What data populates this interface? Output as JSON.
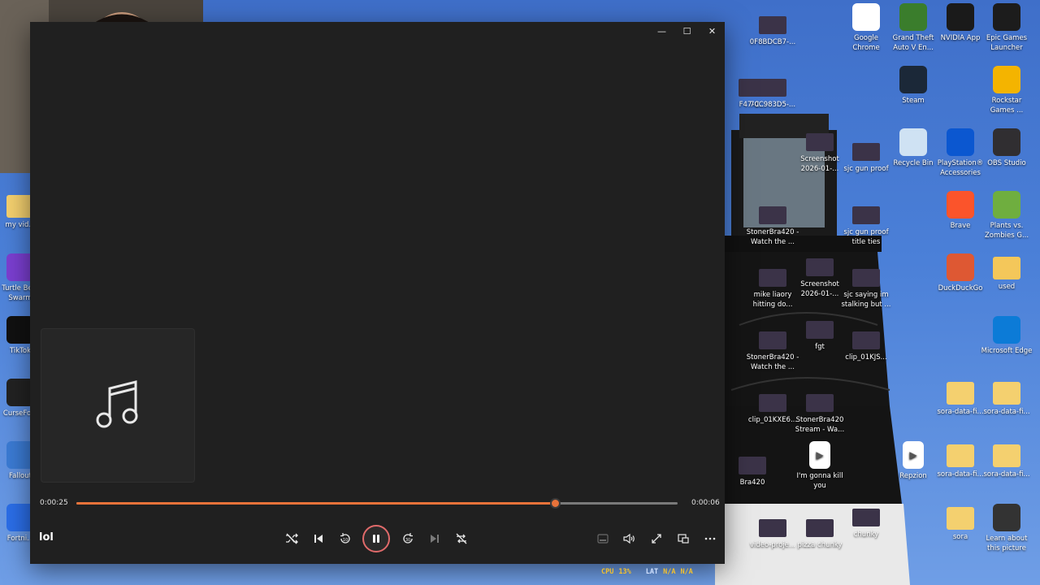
{
  "player": {
    "song_title": "lol",
    "elapsed": "0:00:25",
    "remaining": "0:00:06",
    "progress": 0.796,
    "window_buttons": {
      "minimize": "—",
      "maximize": "☐",
      "close": "✕"
    }
  },
  "overlay_stats": {
    "cpu_label": "CPU",
    "cpu_value": "13%",
    "lat_label": "LAT",
    "lat_value": "N/A",
    "lat_value2": "N/A"
  },
  "desktop": {
    "right_icons": [
      {
        "label": "Google Chrome",
        "icon": "chrome-icon",
        "color": "#ffffff"
      },
      {
        "label": "Grand Theft Auto V En...",
        "icon": "gta-icon",
        "color": "#3a7d2c"
      },
      {
        "label": "NVIDIA App",
        "icon": "nvidia-icon",
        "color": "#1a1a1a"
      },
      {
        "label": "Epic Games Launcher",
        "icon": "epic-icon",
        "color": "#1c1c1c"
      },
      {
        "label": "Steam",
        "icon": "steam-icon",
        "color": "#1b2838"
      },
      {
        "label": "Rockstar Games ...",
        "icon": "rockstar-icon",
        "color": "#f4b400"
      },
      {
        "label": "Recycle Bin",
        "icon": "recycle-bin-icon",
        "color": "#cfe2f3"
      },
      {
        "label": "PlayStation® Accessories",
        "icon": "playstation-icon",
        "color": "#0b57d0"
      },
      {
        "label": "OBS Studio",
        "icon": "obs-icon",
        "color": "#302e31"
      },
      {
        "label": "Brave",
        "icon": "brave-icon",
        "color": "#fb542b"
      },
      {
        "label": "Plants vs. Zombies G...",
        "icon": "pvz-icon",
        "color": "#6fae3f"
      },
      {
        "label": "DuckDuckGo",
        "icon": "duckduckgo-icon",
        "color": "#de5833"
      },
      {
        "label": "used",
        "icon": "folder-icon",
        "color": "#f4c75a"
      },
      {
        "label": "Microsoft Edge",
        "icon": "edge-icon",
        "color": "#0c7bd7"
      },
      {
        "label": "sora-data-fi...",
        "icon": "folder-icon",
        "color": "#f4d06f"
      },
      {
        "label": "sora-data-fi...",
        "icon": "folder-icon",
        "color": "#f4d06f"
      },
      {
        "label": "Repzion",
        "icon": "video-icon",
        "color": "#ffffff"
      },
      {
        "label": "sora-data-fi...",
        "icon": "folder-icon",
        "color": "#f4d06f"
      },
      {
        "label": "sora-data-fi...",
        "icon": "folder-icon",
        "color": "#f4d06f"
      },
      {
        "label": "sora",
        "icon": "folder-icon",
        "color": "#f4d06f"
      },
      {
        "label": "Learn about this picture",
        "icon": "spotlight-icon",
        "color": "#333333"
      }
    ],
    "middle_icons": [
      {
        "label": "0F8BDCB7-...",
        "icon": "thumbnail-icon"
      },
      {
        "label": "70C983D5-...",
        "icon": "thumbnail-icon"
      },
      {
        "label": "Screenshot 2026-01-...",
        "icon": "thumbnail-icon"
      },
      {
        "label": "sjc gun proof",
        "icon": "thumbnail-icon"
      },
      {
        "label": "StonerBra420 - Watch the ...",
        "icon": "thumbnail-icon"
      },
      {
        "label": "sjc gun proof title ties",
        "icon": "thumbnail-icon"
      },
      {
        "label": "mike liaory hitting do...",
        "icon": "thumbnail-icon"
      },
      {
        "label": "Screenshot 2026-01-...",
        "icon": "thumbnail-icon"
      },
      {
        "label": "sjc saying im stalking but ...",
        "icon": "thumbnail-icon"
      },
      {
        "label": "StonerBra420 - Watch the ...",
        "icon": "thumbnail-icon"
      },
      {
        "label": "fgt",
        "icon": "thumbnail-icon"
      },
      {
        "label": "clip_01KJS...",
        "icon": "thumbnail-icon"
      },
      {
        "label": "clip_01KXE6...",
        "icon": "thumbnail-icon"
      },
      {
        "label": "StonerBra420 Stream - Wa...",
        "icon": "thumbnail-icon"
      },
      {
        "label": "Bra420",
        "icon": "thumbnail-icon"
      },
      {
        "label": "I'm gonna kill you",
        "icon": "video-icon"
      },
      {
        "label": "video-proje...",
        "icon": "thumbnail-icon"
      },
      {
        "label": "pizza chunky",
        "icon": "thumbnail-icon"
      },
      {
        "label": "chunky",
        "icon": "thumbnail-icon"
      },
      {
        "label": "F47-C...",
        "icon": "thumbnail-icon"
      }
    ],
    "left_icons": [
      {
        "label": "my vid...",
        "icon": "folder-icon",
        "color": "#f4d06f"
      },
      {
        "label": "Turtle Be... Swarm",
        "icon": "turtle-beach-icon",
        "color": "#7b3fd1"
      },
      {
        "label": "TikTok",
        "icon": "tiktok-icon",
        "color": "#111111"
      },
      {
        "label": "CurseFo...",
        "icon": "curseforge-icon",
        "color": "#222222"
      },
      {
        "label": "Fallout",
        "icon": "fallout-icon",
        "color": "#3b7bd4"
      },
      {
        "label": "Fortni...",
        "icon": "fortnite-icon",
        "color": "#2b6ee8"
      }
    ]
  }
}
